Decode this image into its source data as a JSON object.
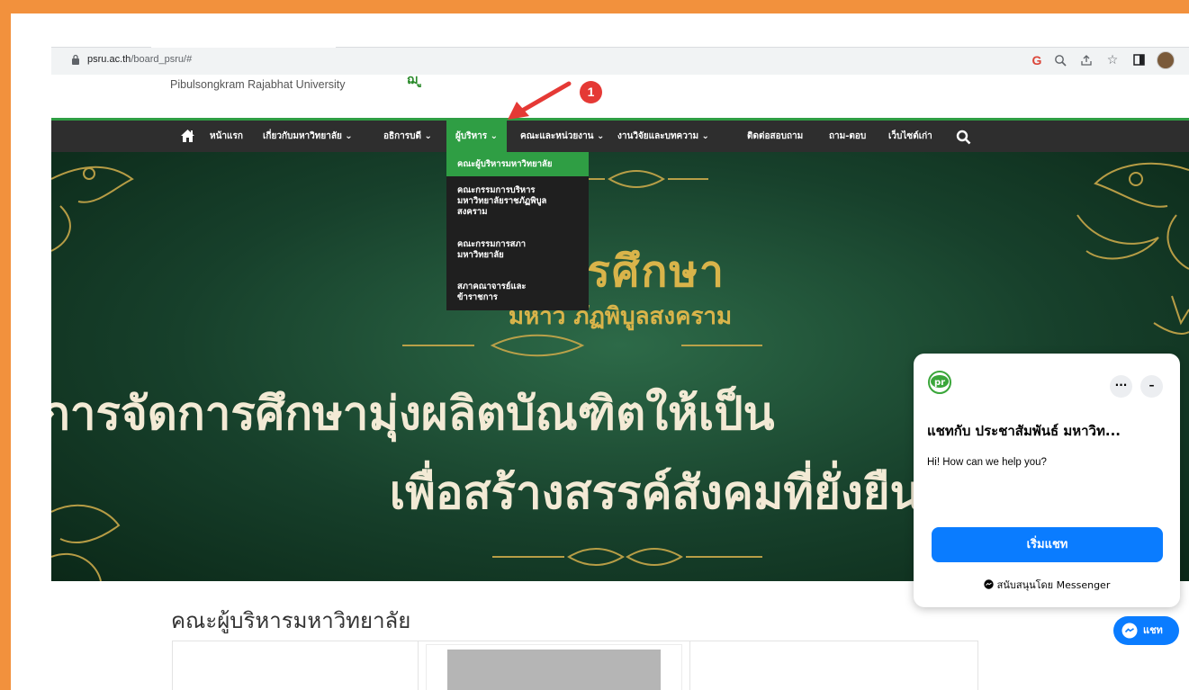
{
  "browser": {
    "url_domain": "psru.ac.th",
    "url_path": "/board_psru/#",
    "toolbar_icons": [
      "google-icon",
      "zoom-icon",
      "share-icon",
      "star-icon",
      "side-panel-icon",
      "profile-avatar"
    ]
  },
  "header": {
    "university_name": "Pibulsongkram Rajabhat University",
    "logo_fragment": "ฌ  ู"
  },
  "nav": {
    "items": [
      {
        "label": "หน้าแรก"
      },
      {
        "label": "เกี่ยวกับมหาวิทยาลัย ⌄"
      },
      {
        "label": "อธิการบดี ⌄"
      },
      {
        "label": "ผู้บริหาร ⌄"
      },
      {
        "label": "คณะและหน่วยงาน ⌄"
      },
      {
        "label": "งานวิจัยและบทความ ⌄"
      },
      {
        "label": "ติดต่อสอบถาม"
      },
      {
        "label": "ถาม-ตอบ"
      },
      {
        "label": "เว็บไซต์เก่า"
      }
    ],
    "active_color": "#2f9e44",
    "bar_color": "#2e2e2e"
  },
  "dropdown": {
    "items": [
      {
        "label": "คณะผู้บริหารมหาวิทยาลัย"
      },
      {
        "label": "คณะกรรมการบริหาร\nมหาวิทยาลัยราชภัฏพิบูล\nสงคราม"
      },
      {
        "label": "คณะกรรมการสภา\nมหาวิทยาลัย"
      },
      {
        "label": "สภาคณาจารย์และ\nข้าราชการ"
      }
    ]
  },
  "annotation": {
    "step": "1",
    "color": "#e53935"
  },
  "banner": {
    "title": "ป      ารศึกษา",
    "subtitle": "มหาว      ภัฏพิบูลสงคราม",
    "line1": "การจัดการศึกษามุ่งผลิตบัณฑิตให้เป็น",
    "line2": "เพื่อสร้างสรรค์สังคมที่ยั่งยืน”"
  },
  "main": {
    "section_title": "คณะผู้บริหารมหาวิทยาลัย"
  },
  "chat": {
    "logo_text": "pr",
    "more_label": "···",
    "minimize_label": "–",
    "title": "แชทกับ ประชาสัมพันธ์ มหาวิท...",
    "greeting": "Hi! How can we help you?",
    "start_button": "เริ่มแชท",
    "powered_by": "สนับสนุนโดย Messenger",
    "launcher_label": "แชท",
    "accent": "#0a7cff"
  }
}
